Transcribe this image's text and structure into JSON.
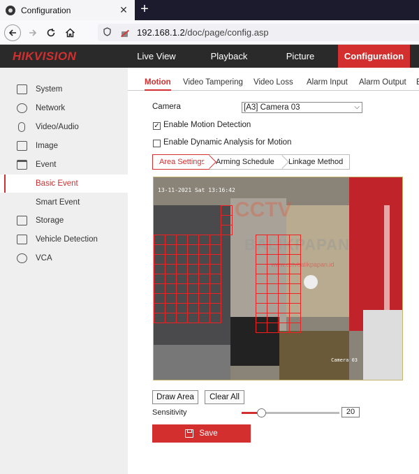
{
  "browser": {
    "tab_title": "Configuration",
    "tab_close": "✕",
    "new_tab": "+",
    "url_host": "192.168.1.2",
    "url_path": "/doc/page/config.asp"
  },
  "header": {
    "logo": "HIKVISION",
    "nav": [
      "Live View",
      "Playback",
      "Picture",
      "Configuration"
    ],
    "active_nav": "Configuration",
    "accent": "#d32f2f"
  },
  "sidebar": {
    "items": [
      {
        "label": "System",
        "icon": "monitor-icon"
      },
      {
        "label": "Network",
        "icon": "globe-icon"
      },
      {
        "label": "Video/Audio",
        "icon": "mic-icon"
      },
      {
        "label": "Image",
        "icon": "image-icon"
      },
      {
        "label": "Event",
        "icon": "calendar-icon"
      },
      {
        "label": "Basic Event",
        "icon": ""
      },
      {
        "label": "Smart Event",
        "icon": ""
      },
      {
        "label": "Storage",
        "icon": "storage-icon"
      },
      {
        "label": "Vehicle Detection",
        "icon": "vehicle-icon"
      },
      {
        "label": "VCA",
        "icon": "vca-icon"
      }
    ],
    "active": "Basic Event"
  },
  "tabs": {
    "items": [
      "Motion",
      "Video Tampering",
      "Video Loss",
      "Alarm Input",
      "Alarm Output",
      "E"
    ],
    "active": "Motion"
  },
  "form": {
    "camera_label": "Camera",
    "camera_value": "[A3] Camera 03",
    "enable_motion_label": "Enable Motion Detection",
    "enable_motion_checked": true,
    "enable_dynamic_label": "Enable Dynamic Analysis for Motion",
    "enable_dynamic_checked": false,
    "steps": [
      "Area Settings",
      "Arming Schedule",
      "Linkage Method"
    ],
    "active_step": "Area Settings"
  },
  "camera_view": {
    "timestamp": "13-11-2021 Sat 13:16:42",
    "camera_name": "Camera 03",
    "watermark_1": "CCTV",
    "watermark_2": "BALIKPAPAN",
    "watermark_3": "www.cctvbalikpapan.id"
  },
  "controls": {
    "draw_area": "Draw Area",
    "clear_all": "Clear All",
    "sensitivity_label": "Sensitivity",
    "sensitivity_value": "20",
    "sensitivity_fraction": 0.2,
    "save": "Save"
  }
}
